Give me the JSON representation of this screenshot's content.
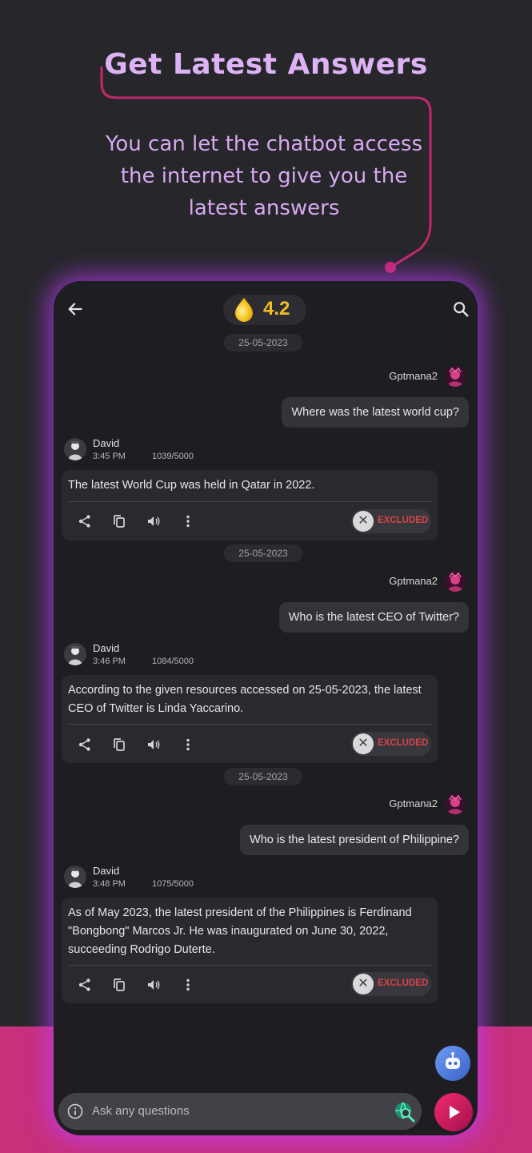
{
  "promo": {
    "title": "Get Latest Answers",
    "subtitle": "You can let the chatbot access the internet to give you the latest answers"
  },
  "header": {
    "credits": "4.2",
    "back_icon": "arrow-left-icon",
    "search_icon": "search-icon",
    "credit_icon": "gold-drop-icon"
  },
  "messages": [
    {
      "date": "25-05-2023",
      "user_name": "Gptmana2",
      "question": "Where was the latest world cup?",
      "bot_name": "David",
      "time": "3:45 PM",
      "count": "1039/5000",
      "answer": "The latest World Cup was held in Qatar in 2022.",
      "status": "EXCLUDED"
    },
    {
      "date": "25-05-2023",
      "user_name": "Gptmana2",
      "question": "Who is the latest CEO of Twitter?",
      "bot_name": "David",
      "time": "3:46 PM",
      "count": "1084/5000",
      "answer": "According to the given resources accessed on 25-05-2023, the latest CEO of Twitter is Linda Yaccarino.",
      "status": "EXCLUDED"
    },
    {
      "date": "25-05-2023",
      "user_name": "Gptmana2",
      "question": "Who is the latest president of Philippine?",
      "bot_name": "David",
      "time": "3:48 PM",
      "count": "1075/5000",
      "answer": "As of May 2023, the latest president of the Philippines is Ferdinand \"Bongbong\" Marcos Jr. He was inaugurated on June 30, 2022, succeeding Rodrigo Duterte.",
      "status": "EXCLUDED"
    }
  ],
  "input": {
    "placeholder": "Ask any questions"
  },
  "colors": {
    "accent": "#c7307a",
    "promo_text": "#ddb3f5",
    "excluded": "#d8444a",
    "credits": "#f3bd22",
    "glow": "#be3cff"
  }
}
